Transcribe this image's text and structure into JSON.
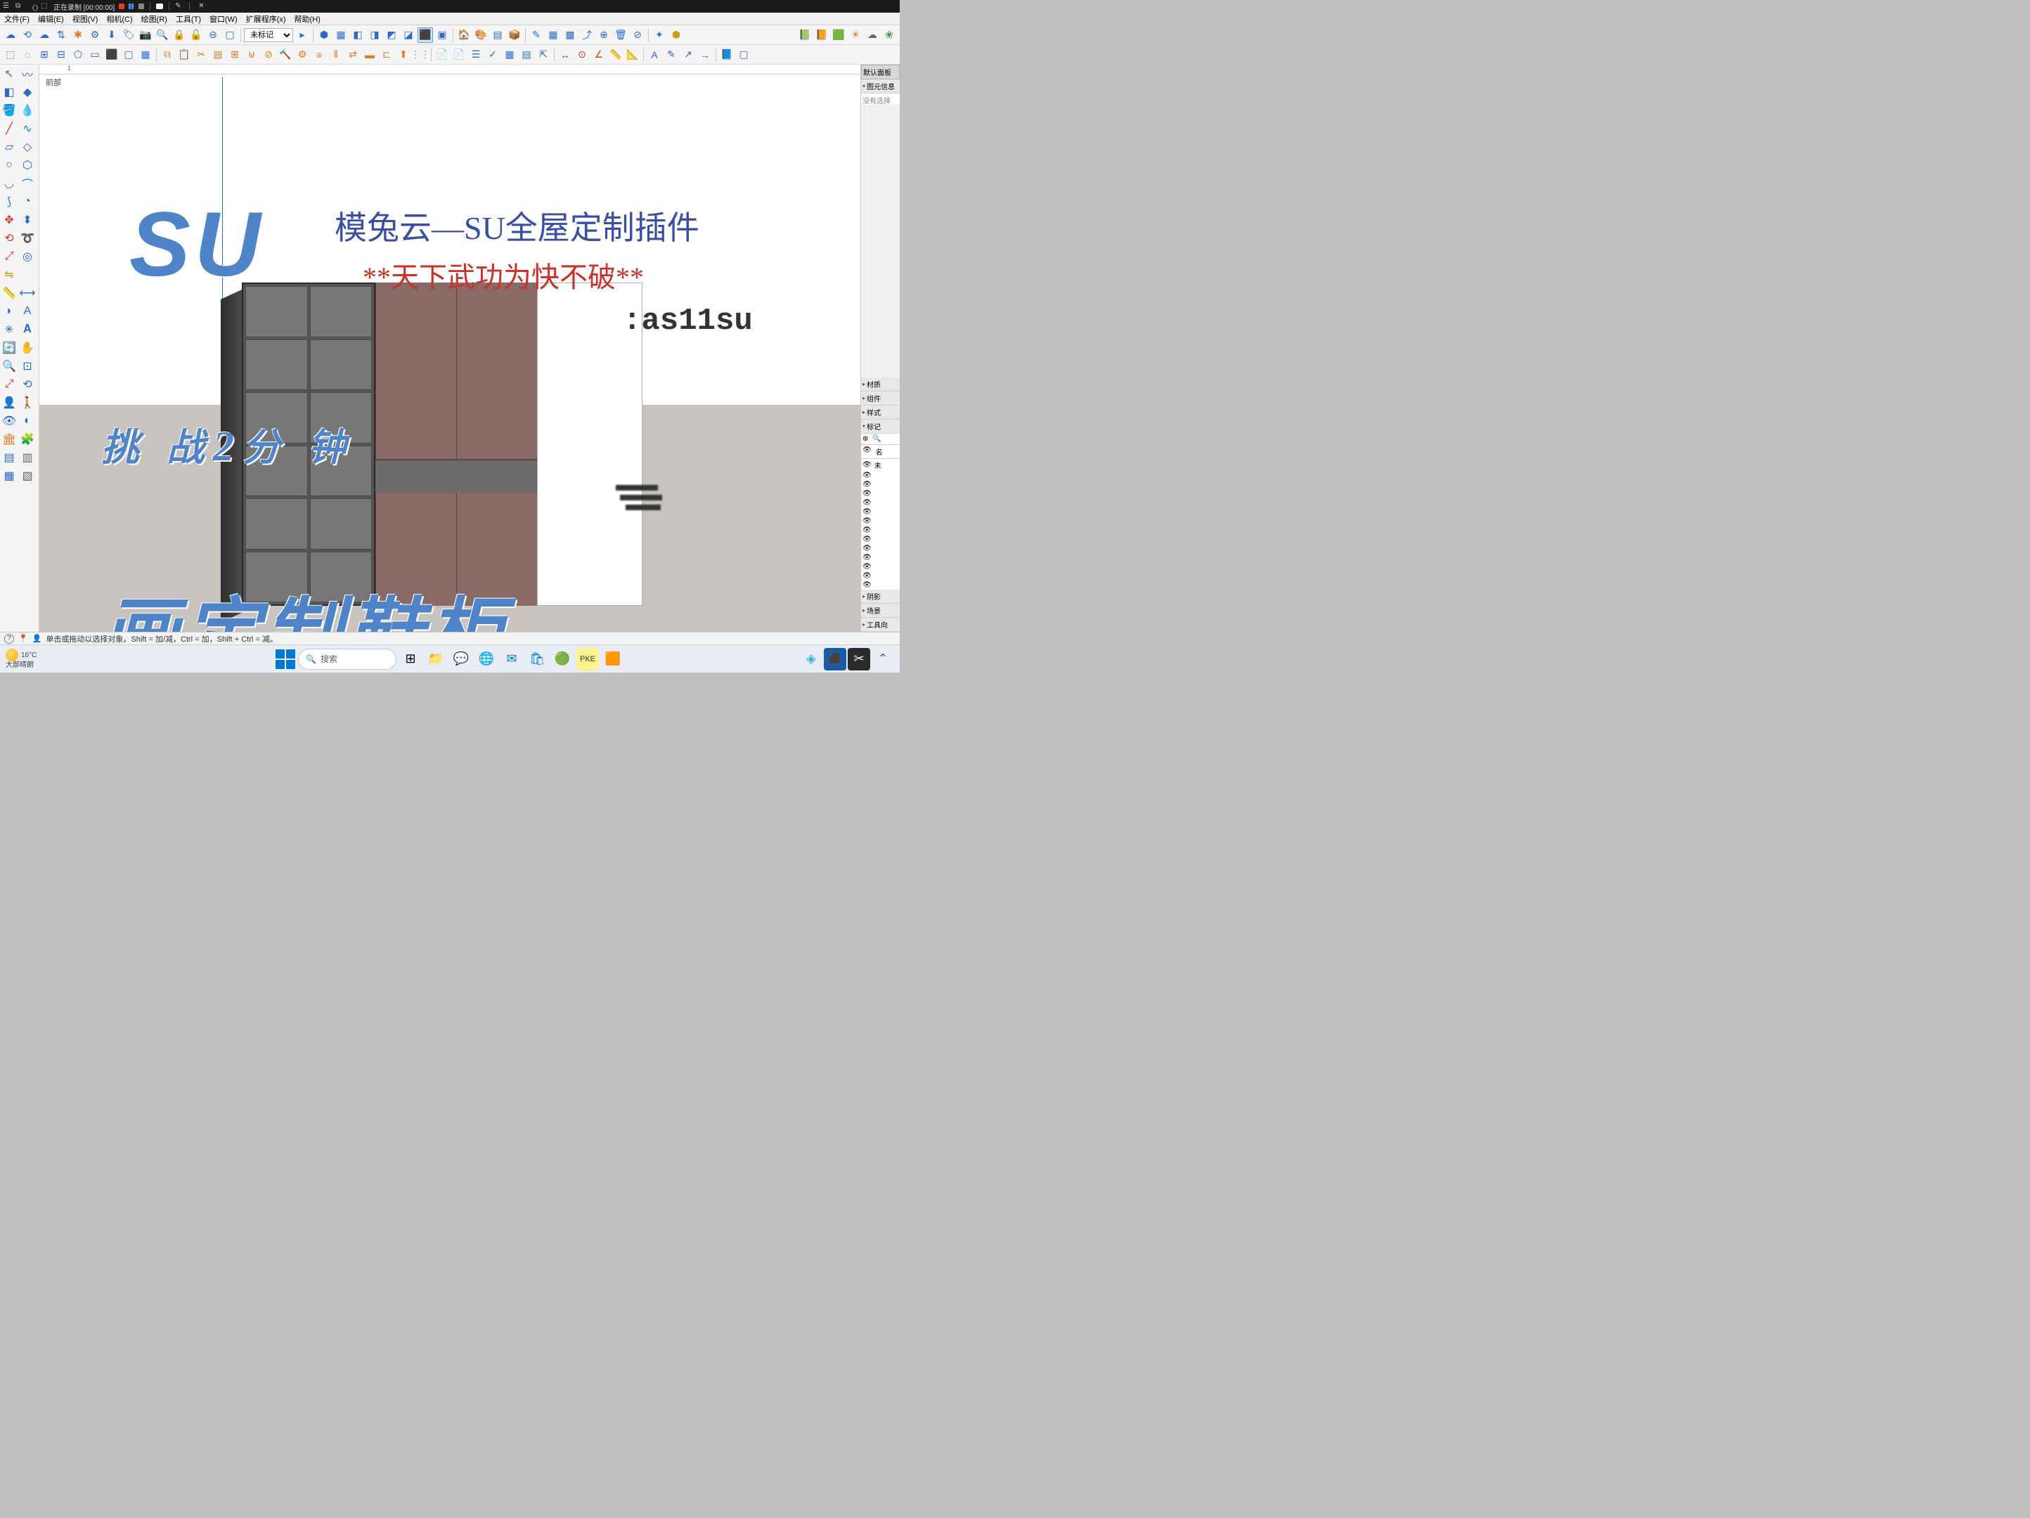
{
  "titlebar": {
    "recording_label": "正在录制 [00:00:00]"
  },
  "menu": {
    "items": [
      "文件(F)",
      "编辑(E)",
      "视图(V)",
      "相机(C)",
      "绘图(R)",
      "工具(T)",
      "窗口(W)",
      "扩展程序(x)",
      "帮助(H)"
    ]
  },
  "tag_dropdown": "未标记",
  "ruler_mark": "1",
  "scene_label": "前部",
  "overlay": {
    "su": "SU",
    "title": "模兔云—SU全屋定制插件",
    "motto": "**天下武功为快不破**",
    "code": ":as11su",
    "challenge_pre": "挑 战",
    "challenge_num": "2",
    "challenge_post": "分 钟",
    "bottom": "画定制鞋柜"
  },
  "right_panel": {
    "header": "默认面板",
    "sections": {
      "entity_info": "图元信息",
      "none_selected": "没有选择",
      "styles": "样式",
      "materials": "材质",
      "components": "组件",
      "styles2": "样式",
      "tags": "标记",
      "name_col": "名",
      "untagged": "未",
      "shadows": "阴影",
      "scenes": "场景",
      "instructor": "工具向"
    }
  },
  "status": {
    "hint": "单击或拖动以选择对象。Shift = 加/减，Ctrl = 加，Shift + Ctrl = 减。"
  },
  "taskbar": {
    "temp": "16°C",
    "weather": "大部晴朗",
    "search_placeholder": "搜索"
  }
}
